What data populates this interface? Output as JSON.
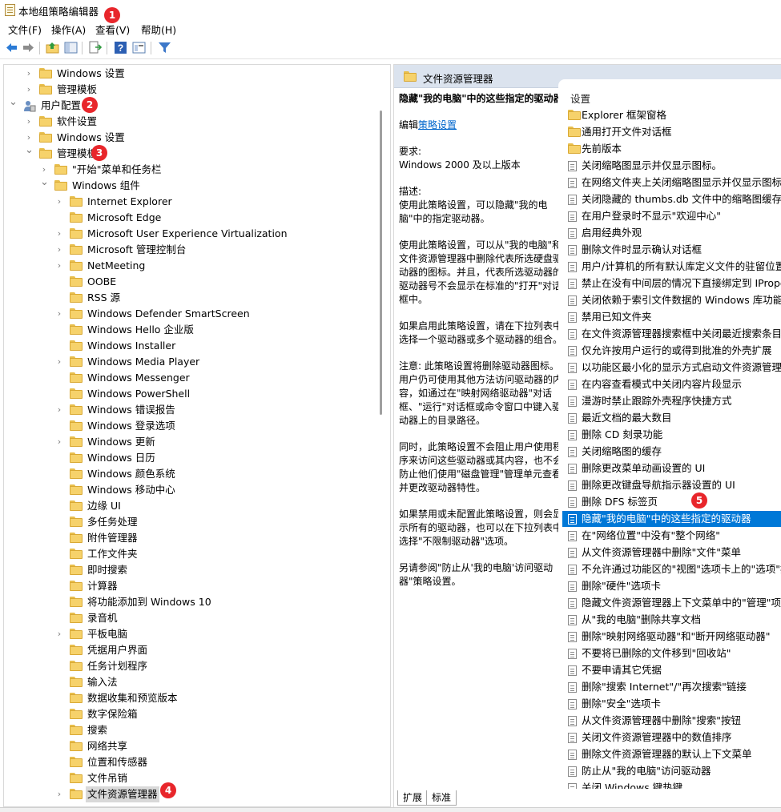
{
  "window": {
    "title": "本地组策略编辑器"
  },
  "menu": [
    "文件(F)",
    "操作(A)",
    "查看(V)",
    "帮助(H)"
  ],
  "toolbar": [
    "back-icon",
    "forward-icon",
    "up-folder-icon",
    "show-hide-tree-icon",
    "export-list-icon",
    "help-icon",
    "properties-icon",
    "filter-icon"
  ],
  "badges": [
    "1",
    "2",
    "3",
    "4",
    "5"
  ],
  "tree": [
    {
      "label": "Windows 设置",
      "indent": 1,
      "chevron": "right"
    },
    {
      "label": "管理模板",
      "indent": 1,
      "chevron": "right"
    },
    {
      "label": "用户配置",
      "indent": 0,
      "chevron": "down",
      "icon": "user"
    },
    {
      "label": "软件设置",
      "indent": 1,
      "chevron": "right"
    },
    {
      "label": "Windows 设置",
      "indent": 1,
      "chevron": "right"
    },
    {
      "label": "管理模板",
      "indent": 1,
      "chevron": "down"
    },
    {
      "label": "\"开始\"菜单和任务栏",
      "indent": 2,
      "chevron": "right"
    },
    {
      "label": "Windows 组件",
      "indent": 2,
      "chevron": "down"
    },
    {
      "label": "Internet Explorer",
      "indent": 3,
      "chevron": "right"
    },
    {
      "label": "Microsoft Edge",
      "indent": 3,
      "chevron": ""
    },
    {
      "label": "Microsoft User Experience Virtualization",
      "indent": 3,
      "chevron": "right"
    },
    {
      "label": "Microsoft 管理控制台",
      "indent": 3,
      "chevron": "right"
    },
    {
      "label": "NetMeeting",
      "indent": 3,
      "chevron": "right"
    },
    {
      "label": "OOBE",
      "indent": 3,
      "chevron": ""
    },
    {
      "label": "RSS 源",
      "indent": 3,
      "chevron": ""
    },
    {
      "label": "Windows Defender SmartScreen",
      "indent": 3,
      "chevron": "right"
    },
    {
      "label": "Windows Hello 企业版",
      "indent": 3,
      "chevron": ""
    },
    {
      "label": "Windows Installer",
      "indent": 3,
      "chevron": ""
    },
    {
      "label": "Windows Media Player",
      "indent": 3,
      "chevron": "right"
    },
    {
      "label": "Windows Messenger",
      "indent": 3,
      "chevron": ""
    },
    {
      "label": "Windows PowerShell",
      "indent": 3,
      "chevron": ""
    },
    {
      "label": "Windows 错误报告",
      "indent": 3,
      "chevron": "right"
    },
    {
      "label": "Windows 登录选项",
      "indent": 3,
      "chevron": ""
    },
    {
      "label": "Windows 更新",
      "indent": 3,
      "chevron": "right"
    },
    {
      "label": "Windows 日历",
      "indent": 3,
      "chevron": ""
    },
    {
      "label": "Windows 颜色系统",
      "indent": 3,
      "chevron": ""
    },
    {
      "label": "Windows 移动中心",
      "indent": 3,
      "chevron": ""
    },
    {
      "label": "边缘 UI",
      "indent": 3,
      "chevron": ""
    },
    {
      "label": "多任务处理",
      "indent": 3,
      "chevron": ""
    },
    {
      "label": "附件管理器",
      "indent": 3,
      "chevron": ""
    },
    {
      "label": "工作文件夹",
      "indent": 3,
      "chevron": ""
    },
    {
      "label": "即时搜索",
      "indent": 3,
      "chevron": ""
    },
    {
      "label": "计算器",
      "indent": 3,
      "chevron": ""
    },
    {
      "label": "将功能添加到 Windows 10",
      "indent": 3,
      "chevron": ""
    },
    {
      "label": "录音机",
      "indent": 3,
      "chevron": ""
    },
    {
      "label": "平板电脑",
      "indent": 3,
      "chevron": "right"
    },
    {
      "label": "凭据用户界面",
      "indent": 3,
      "chevron": ""
    },
    {
      "label": "任务计划程序",
      "indent": 3,
      "chevron": ""
    },
    {
      "label": "输入法",
      "indent": 3,
      "chevron": ""
    },
    {
      "label": "数据收集和预览版本",
      "indent": 3,
      "chevron": ""
    },
    {
      "label": "数字保险箱",
      "indent": 3,
      "chevron": ""
    },
    {
      "label": "搜索",
      "indent": 3,
      "chevron": ""
    },
    {
      "label": "网络共享",
      "indent": 3,
      "chevron": ""
    },
    {
      "label": "位置和传感器",
      "indent": 3,
      "chevron": ""
    },
    {
      "label": "文件吊销",
      "indent": 3,
      "chevron": ""
    },
    {
      "label": "文件资源管理器",
      "indent": 3,
      "chevron": "right",
      "selected": true
    }
  ],
  "right": {
    "header": "文件资源管理器",
    "desc_title": "隐藏\"我的电脑\"中的这些指定的驱动器",
    "edit_prefix": "编辑",
    "edit_link": "策略设置",
    "paragraphs": [
      "要求:\nWindows 2000 及以上版本",
      "描述:\n使用此策略设置，可以隐藏\"我的电脑\"中的指定驱动器。",
      "使用此策略设置，可以从\"我的电脑\"和文件资源管理器中删除代表所选硬盘驱动器的图标。并且，代表所选驱动器的驱动器号不会显示在标准的\"打开\"对话框中。",
      "如果启用此策略设置，请在下拉列表中选择一个驱动器或多个驱动器的组合。",
      "注意: 此策略设置将删除驱动器图标。用户仍可使用其他方法访问驱动器的内容，如通过在\"映射网络驱动器\"对话框、\"运行\"对话框或命令窗口中键入驱动器上的目录路径。",
      "同时，此策略设置不会阻止用户使用程序来访问这些驱动器或其内容，也不会防止他们使用\"磁盘管理\"管理单元查看并更改驱动器特性。",
      "如果禁用或未配置此策略设置，则会显示所有的驱动器，也可以在下拉列表中选择\"不限制驱动器\"选项。",
      "另请参阅\"防止从'我的电脑'访问驱动器\"策略设置。"
    ],
    "list_header": "设置",
    "items": [
      {
        "label": "Explorer 框架窗格",
        "type": "folder"
      },
      {
        "label": "通用打开文件对话框",
        "type": "folder"
      },
      {
        "label": "先前版本",
        "type": "folder"
      },
      {
        "label": "关闭缩略图显示并仅显示图标。",
        "type": "policy"
      },
      {
        "label": "在网络文件夹上关闭缩略图显示并仅显示图标",
        "type": "policy"
      },
      {
        "label": "关闭隐藏的 thumbs.db 文件中的缩略图缓存",
        "type": "policy"
      },
      {
        "label": "在用户登录时不显示\"欢迎中心\"",
        "type": "policy"
      },
      {
        "label": "启用经典外观",
        "type": "policy"
      },
      {
        "label": "删除文件时显示确认对话框",
        "type": "policy"
      },
      {
        "label": "用户/计算机的所有默认库定义文件的驻留位置",
        "type": "policy"
      },
      {
        "label": "禁止在没有中间层的情况下直接绑定到 IPropertySetStorage",
        "type": "policy"
      },
      {
        "label": "关闭依赖于索引文件数据的 Windows 库功能",
        "type": "policy"
      },
      {
        "label": "禁用已知文件夹",
        "type": "policy"
      },
      {
        "label": "在文件资源管理器搜索框中关闭最近搜索条目的显示",
        "type": "policy"
      },
      {
        "label": "仅允许按用户运行的或得到批准的外壳扩展",
        "type": "policy"
      },
      {
        "label": "以功能区最小化的显示方式启动文件资源管理器",
        "type": "policy"
      },
      {
        "label": "在内容查看模式中关闭内容片段显示",
        "type": "policy"
      },
      {
        "label": "漫游时禁止跟踪外壳程序快捷方式",
        "type": "policy"
      },
      {
        "label": "最近文档的最大数目",
        "type": "policy"
      },
      {
        "label": "删除 CD 刻录功能",
        "type": "policy"
      },
      {
        "label": "关闭缩略图的缓存",
        "type": "policy"
      },
      {
        "label": "删除更改菜单动画设置的 UI",
        "type": "policy"
      },
      {
        "label": "删除更改键盘导航指示器设置的 UI",
        "type": "policy"
      },
      {
        "label": "删除 DFS 标签页",
        "type": "policy"
      },
      {
        "label": "隐藏\"我的电脑\"中的这些指定的驱动器",
        "type": "policy",
        "selected": true
      },
      {
        "label": "在\"网络位置\"中没有\"整个网络\"",
        "type": "policy"
      },
      {
        "label": "从文件资源管理器中删除\"文件\"菜单",
        "type": "policy"
      },
      {
        "label": "不允许通过功能区的\"视图\"选项卡上的\"选项\"按钮打开\"文件夹选项\"",
        "type": "policy"
      },
      {
        "label": "删除\"硬件\"选项卡",
        "type": "policy"
      },
      {
        "label": "隐藏文件资源管理器上下文菜单中的\"管理\"项目",
        "type": "policy"
      },
      {
        "label": "从\"我的电脑\"删除共享文档",
        "type": "policy"
      },
      {
        "label": "删除\"映射网络驱动器\"和\"断开网络驱动器\"",
        "type": "policy"
      },
      {
        "label": "不要将已删除的文件移到\"回收站\"",
        "type": "policy"
      },
      {
        "label": "不要申请其它凭据",
        "type": "policy"
      },
      {
        "label": "删除\"搜索 Internet\"/\"再次搜索\"链接",
        "type": "policy"
      },
      {
        "label": "删除\"安全\"选项卡",
        "type": "policy"
      },
      {
        "label": "从文件资源管理器中删除\"搜索\"按钮",
        "type": "policy"
      },
      {
        "label": "关闭文件资源管理器中的数值排序",
        "type": "policy"
      },
      {
        "label": "删除文件资源管理器的默认上下文菜单",
        "type": "policy"
      },
      {
        "label": "防止从\"我的电脑\"访问驱动器",
        "type": "policy"
      },
      {
        "label": "关闭 Windows 键热键",
        "type": "policy"
      }
    ],
    "tabs": [
      "扩展",
      "标准"
    ]
  }
}
